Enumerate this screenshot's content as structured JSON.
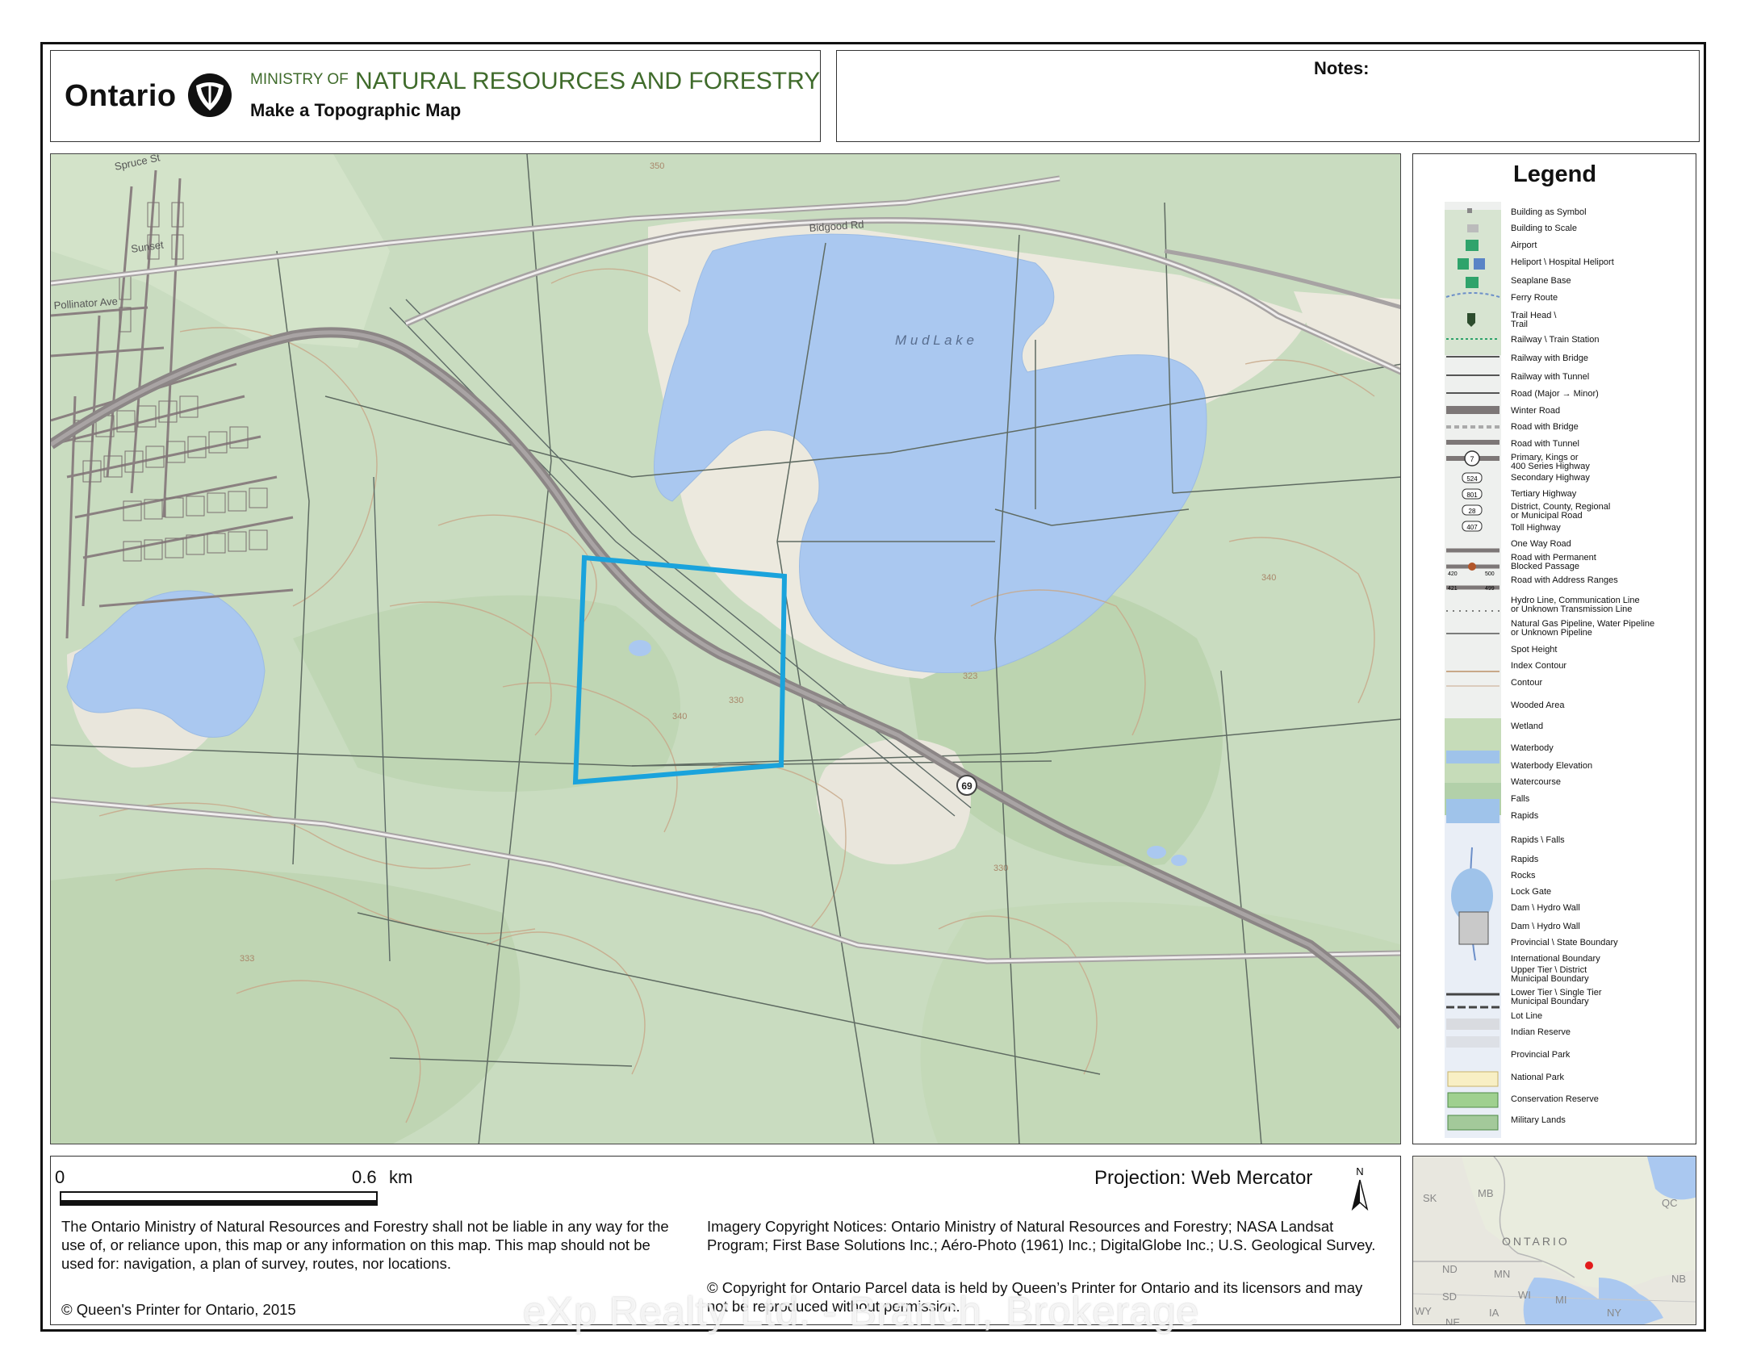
{
  "header": {
    "ontario": "Ontario",
    "ministry_prefix": "MINISTRY OF",
    "ministry_name": "NATURAL RESOURCES AND FORESTRY",
    "subtitle": "Make a Topographic Map",
    "notes_label": "Notes:"
  },
  "map": {
    "lake_label": "M u d   L a k e",
    "road_labels": [
      "Bidgood Rd",
      "Sunset",
      "Pollinator Ave",
      "Spruce St"
    ],
    "highway_shield": "69",
    "contour_labels": [
      "350",
      "330",
      "340",
      "323",
      "333",
      "340",
      "330"
    ],
    "colors": {
      "land": "#c9dcc0",
      "water": "#aac8f0",
      "parcel": "#1aa3dc",
      "road": "#8c8686",
      "clearing": "#ece9de"
    }
  },
  "legend": {
    "title": "Legend",
    "items": [
      "Building as Symbol",
      "Building to Scale",
      "Airport",
      "Heliport \\ Hospital Heliport",
      "Seaplane Base",
      "Ferry Route",
      "Trail Head \\\nTrail",
      "Railway \\ Train Station",
      "Railway with Bridge",
      "Railway with Tunnel",
      "Road (Major → Minor)",
      "Winter Road",
      "Road with Bridge",
      "Road with Tunnel",
      "Primary, Kings or\n400 Series Highway",
      "Secondary Highway",
      "Tertiary Highway",
      "District, County, Regional\nor Municipal Road",
      "Toll Highway",
      "One Way Road",
      "Road with Permanent\nBlocked Passage",
      "Road with Address Ranges",
      "Hydro Line, Communication Line\nor Unknown Transmission Line",
      "Natural Gas Pipeline, Water Pipeline\nor Unknown Pipeline",
      "Spot Height",
      "Index Contour",
      "Contour",
      "Wooded Area",
      "Wetland",
      "Waterbody",
      "Waterbody Elevation",
      "Watercourse",
      "Falls",
      "Rapids",
      "Rapids \\ Falls",
      "Rapids",
      "Rocks",
      "Lock Gate",
      "Dam \\ Hydro Wall",
      "Dam \\ Hydro Wall",
      "Provincial \\ State Boundary",
      "International Boundary",
      "Upper Tier \\ District\nMunicipal Boundary",
      "Lower Tier \\ Single Tier\nMunicipal Boundary",
      "Lot Line",
      "Indian Reserve",
      "Provincial Park",
      "National Park",
      "Conservation Reserve",
      "Military Lands"
    ],
    "shields": [
      "7",
      "524",
      "801",
      "28",
      "407"
    ],
    "address_range": [
      "420",
      "500",
      "421",
      "499"
    ]
  },
  "footer": {
    "scale_zero": "0",
    "scale_max": "0.6",
    "scale_unit": "km",
    "projection": "Projection: Web Mercator",
    "north": "N",
    "disclaimer": "The Ontario Ministry of Natural Resources and Forestry shall not be liable in any way for the use of, or reliance upon, this map or any information on this map.  This map should not be used for: navigation, a plan of survey, routes, nor locations.",
    "copyright": "© Queen's Printer for Ontario, 2015",
    "imagery": "Imagery Copyright Notices: Ontario Ministry of Natural Resources and Forestry; NASA Landsat Program; First Base Solutions Inc.; Aéro-Photo (1961) Inc.; DigitalGlobe Inc.; U.S. Geological Survey.",
    "parcel": "© Copyright for Ontario Parcel data is held by Queen’s Printer for Ontario and its licensors and may not be reproduced without permission.",
    "watermark": "eXp Realty Ltd. - Branch, Brokerage"
  },
  "inset": {
    "labels": [
      "SK",
      "MB",
      "ONTARIO",
      "QC",
      "ND",
      "MN",
      "NB",
      "SD",
      "WI",
      "MI",
      "WY",
      "IA",
      "NY",
      "NE"
    ],
    "marker_color": "#e21b1b"
  }
}
